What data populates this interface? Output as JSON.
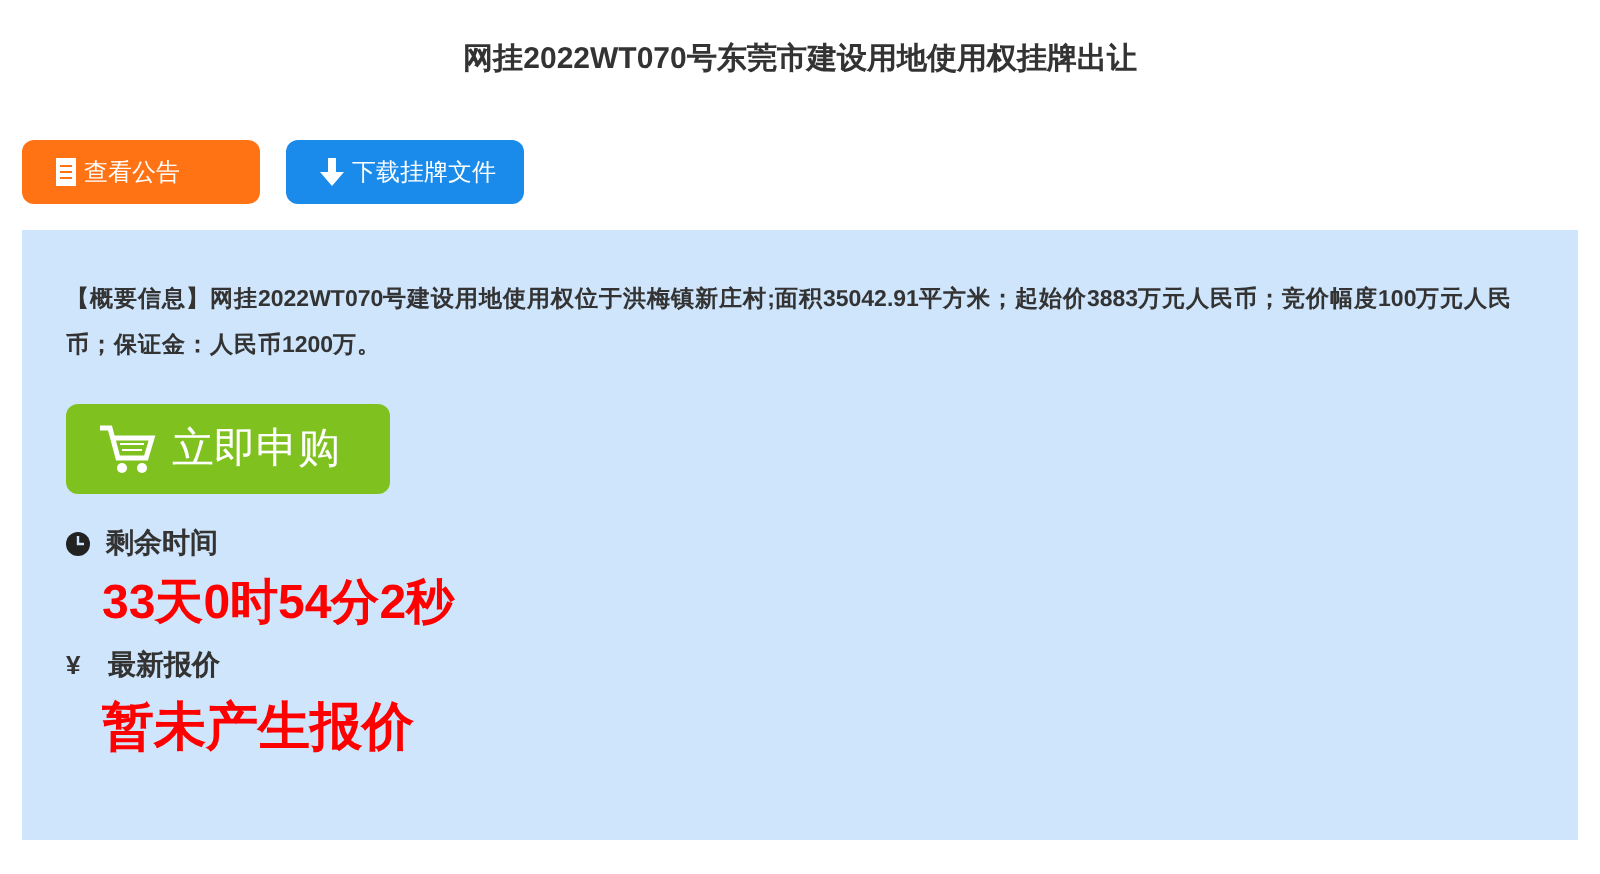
{
  "title": "网挂2022WT070号东莞市建设用地使用权挂牌出让",
  "buttons": [
    {
      "label": "查看公告",
      "kind": "notice"
    },
    {
      "label": "下载挂牌文件",
      "kind": "download"
    }
  ],
  "summary": "【概要信息】网挂2022WT070号建设用地使用权位于洪梅镇新庄村;面积35042.91平方米；起始价3883万元人民币；竞价幅度100万元人民币；保证金：人民币1200万。",
  "apply_button": {
    "label": "立即申购"
  },
  "remaining": {
    "label": "剩余时间",
    "value": "33天0时54分2秒"
  },
  "latest_bid": {
    "symbol": "¥",
    "label": "最新报价",
    "value": "暂未产生报价"
  }
}
